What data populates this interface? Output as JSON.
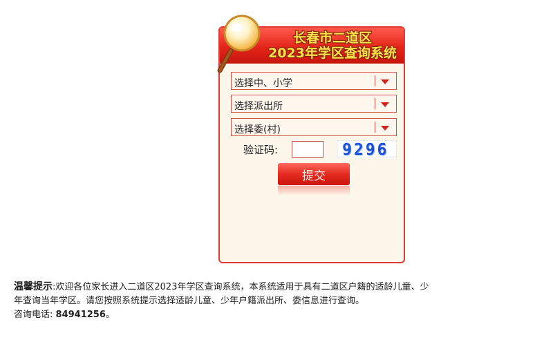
{
  "panel": {
    "title_line1": "长春市二道区",
    "title_line2": "2023年学区查询系统",
    "colors": {
      "accent": "#e3251b",
      "title_text": "#ffe14d",
      "panel_bg": "#fdf6ea"
    }
  },
  "form": {
    "school_select": {
      "selected": "选择中、小学"
    },
    "police_select": {
      "selected": "选择派出所"
    },
    "committee_select": {
      "selected": "选择委(村)"
    },
    "captcha_label": "验证码:",
    "captcha_value": "",
    "captcha_code": "9296",
    "submit_label": "提交"
  },
  "notice": {
    "heading": "温馨提示",
    "line1": ":欢迎各位家长进入二道区2023年学区查询系统，本系统适用于具有二道区户籍的适龄儿童、少",
    "line2": "年查询当年学区。请您按照系统提示选择适龄儿童、少年户籍派出所、委信息进行查询。",
    "phone_label": "咨询电话:",
    "phone_number": "84941256",
    "phone_suffix": "。"
  }
}
